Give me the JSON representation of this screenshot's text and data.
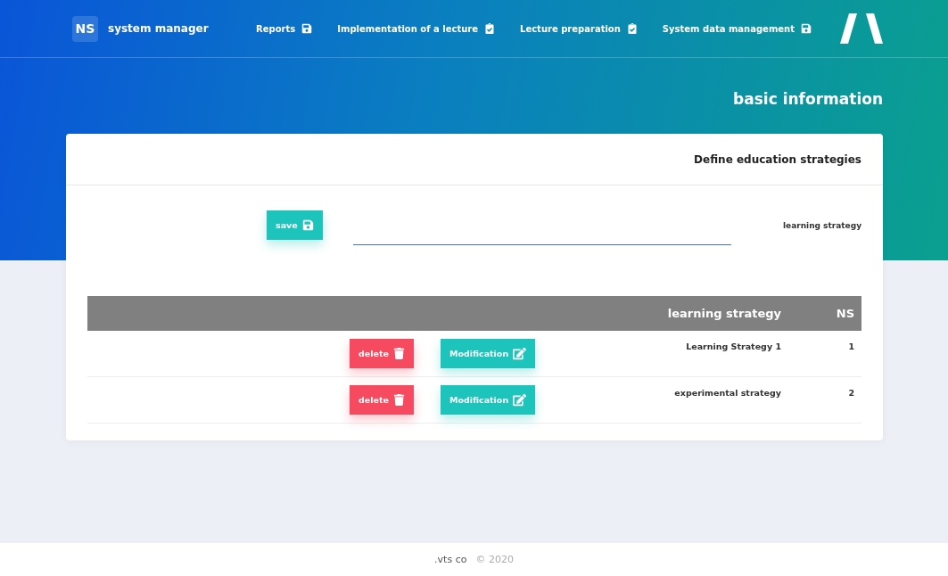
{
  "brand": {
    "badge": "NS",
    "title": "system manager"
  },
  "nav": [
    {
      "label": "Reports",
      "kind": "save"
    },
    {
      "label": "Implementation of a lecture",
      "kind": "clipboard"
    },
    {
      "label": "Lecture preparation",
      "kind": "clipboard"
    },
    {
      "label": "System data management",
      "kind": "save"
    }
  ],
  "page_title": "basic information",
  "card": {
    "title": "Define education strategies",
    "form": {
      "label": "learning strategy",
      "save_button": "save"
    },
    "table": {
      "columns": [
        "learning strategy",
        "NS"
      ],
      "rows": [
        {
          "strategy": "Learning Strategy 1",
          "ns": "1",
          "delete": "delete",
          "modify": "Modification"
        },
        {
          "strategy": "experimental strategy",
          "ns": "2",
          "delete": "delete",
          "modify": "Modification"
        }
      ]
    }
  },
  "footer": {
    "company": ".vts co",
    "copyright": "© 2020"
  }
}
